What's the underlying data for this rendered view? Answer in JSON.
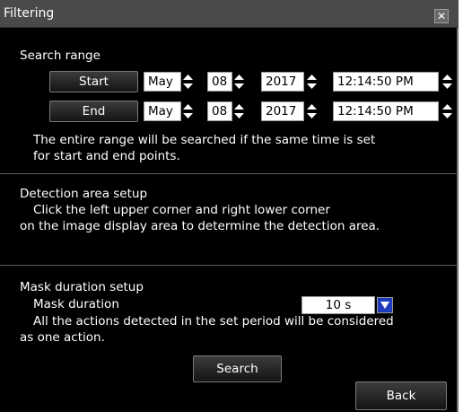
{
  "dialog": {
    "title": "Filtering",
    "close_glyph": "✕"
  },
  "search_range": {
    "heading": "Search range",
    "start": {
      "button_label": "Start",
      "month": "May",
      "day": "08",
      "year": "2017",
      "time": "12:14:50 PM"
    },
    "end": {
      "button_label": "End",
      "month": "May",
      "day": "08",
      "year": "2017",
      "time": "12:14:50 PM"
    },
    "note_line1": "The entire range will be searched if the same time is set",
    "note_line2": "for start and end points."
  },
  "detection_area": {
    "heading": "Detection area setup",
    "line1": "Click the left upper corner and right lower corner",
    "line2": "on the image display area to determine the detection area."
  },
  "mask_duration": {
    "heading": "Mask duration setup",
    "label": "Mask duration",
    "value": "10 s",
    "note_line1": "All the actions detected in the set period will be considered",
    "note_line2": "as one action."
  },
  "buttons": {
    "search": "Search",
    "back": "Back"
  },
  "icons": {
    "spinner": "up-down-arrows-icon",
    "dropdown": "triangle-down-icon",
    "close": "close-icon"
  },
  "colors": {
    "background": "#000000",
    "titlebar": "#4a4a4a",
    "accent": "#1f3bbd",
    "field": "#ffffff"
  }
}
